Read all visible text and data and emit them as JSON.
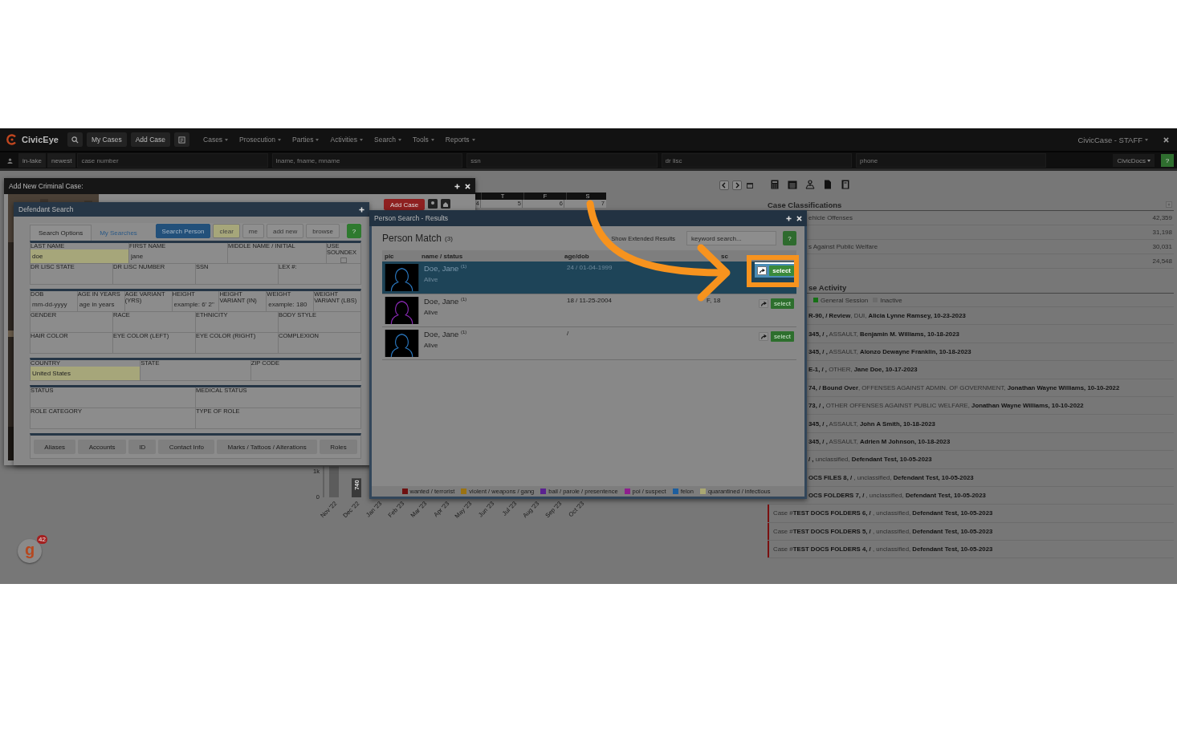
{
  "nav": {
    "brand": "CivicEye",
    "buttons": [
      "My Cases",
      "Add Case"
    ],
    "menus": [
      "Cases",
      "Prosecution",
      "Parties",
      "Activities",
      "Search",
      "Tools",
      "Reports"
    ],
    "account": "CivicCase - STAFF"
  },
  "search_bar": {
    "toggles": [
      "in-take",
      "newest"
    ],
    "fields": [
      {
        "placeholder": "case number"
      },
      {
        "placeholder": "lname, fname, mname"
      },
      {
        "placeholder": "ssn"
      },
      {
        "placeholder": "dr lisc"
      },
      {
        "placeholder": "phone"
      }
    ],
    "docs_menu": "CivicDocs",
    "help": "?"
  },
  "calendar": {
    "days": [
      "T",
      "F",
      "S"
    ],
    "dates": [
      "4",
      "5",
      "6",
      "7"
    ]
  },
  "add_case_modal": {
    "title": "Add New Criminal Case:",
    "add_button": "Add Case"
  },
  "defendant_search": {
    "title": "Defendant Search",
    "tabs": [
      {
        "label": "Search Options",
        "selected": true
      },
      {
        "label": "My Searches",
        "selected": false
      }
    ],
    "buttons": [
      {
        "label": "Search Person",
        "kind": "primary"
      },
      {
        "label": "clear",
        "kind": "warning"
      },
      {
        "label": "me",
        "kind": "plain"
      },
      {
        "label": "add new",
        "kind": "plain"
      },
      {
        "label": "browse",
        "kind": "plain"
      },
      {
        "label": "?",
        "kind": "help"
      }
    ],
    "sections": [
      [
        [
          {
            "label": "LAST NAME",
            "value": "doe",
            "highlighted": true,
            "kind": "text"
          },
          {
            "label": "FIRST NAME",
            "value": "jane",
            "highlighted": false,
            "kind": "text"
          },
          {
            "label": "MIDDLE NAME / INITIAL",
            "highlighted": false,
            "kind": "text"
          },
          {
            "label": "USE SOUNDEX",
            "checked": false,
            "kind": "checkbox"
          }
        ],
        [
          {
            "label": "DR LISC STATE",
            "highlighted": false,
            "kind": "text"
          },
          {
            "label": "DR LISC NUMBER",
            "highlighted": false,
            "kind": "text"
          },
          {
            "label": "SSN",
            "highlighted": false,
            "kind": "text"
          },
          {
            "label": "LEX #:",
            "highlighted": false,
            "kind": "text"
          }
        ]
      ],
      [
        [
          {
            "label": "DOB",
            "placeholder": "mm-dd-yyyy",
            "highlighted": false,
            "kind": "text"
          },
          {
            "label": "AGE IN YEARS",
            "placeholder": "age in years",
            "highlighted": false,
            "kind": "text"
          },
          {
            "label": "AGE VARIANT (YRS)",
            "highlighted": false,
            "kind": "text"
          },
          {
            "label": "HEIGHT",
            "placeholder": "example: 6' 2\"",
            "highlighted": false,
            "kind": "text"
          },
          {
            "label": "HEIGHT VARIANT (IN)",
            "highlighted": false,
            "kind": "text"
          },
          {
            "label": "WEIGHT",
            "placeholder": "example: 180",
            "highlighted": false,
            "kind": "text"
          },
          {
            "label": "WEIGHT VARIANT (LBS)",
            "highlighted": false,
            "kind": "text"
          }
        ],
        [
          {
            "label": "GENDER",
            "highlighted": false,
            "kind": "text"
          },
          {
            "label": "RACE",
            "highlighted": false,
            "kind": "text"
          },
          {
            "label": "ETHNICITY",
            "highlighted": false,
            "kind": "text"
          },
          {
            "label": "BODY STYLE",
            "highlighted": false,
            "kind": "text"
          }
        ],
        [
          {
            "label": "HAIR COLOR",
            "highlighted": false,
            "kind": "text"
          },
          {
            "label": "EYE COLOR (LEFT)",
            "highlighted": false,
            "kind": "text"
          },
          {
            "label": "EYE COLOR (RIGHT)",
            "highlighted": false,
            "kind": "text"
          },
          {
            "label": "COMPLEXION",
            "highlighted": false,
            "kind": "text"
          }
        ]
      ],
      [
        [
          {
            "label": "COUNTRY",
            "value": "United States",
            "highlighted": true,
            "kind": "text"
          },
          {
            "label": "STATE",
            "highlighted": false,
            "kind": "text"
          },
          {
            "label": "ZIP CODE",
            "highlighted": false,
            "kind": "text"
          }
        ]
      ],
      [
        [
          {
            "label": "STATUS",
            "highlighted": false,
            "kind": "text"
          },
          {
            "label": "MEDICAL STATUS",
            "highlighted": false,
            "kind": "text"
          }
        ],
        [
          {
            "label": "ROLE CATEGORY",
            "highlighted": false,
            "kind": "text"
          },
          {
            "label": "TYPE OF ROLE",
            "highlighted": false,
            "kind": "text"
          }
        ]
      ]
    ],
    "sub_tabs": [
      "Aliases",
      "Accounts",
      "ID",
      "Contact Info",
      "Marks / Tattoos / Alterations",
      "Roles"
    ]
  },
  "person_search": {
    "title": "Person Search - Results",
    "heading": "Person Match",
    "count": "(3)",
    "extended": {
      "label": "Show Extended Results"
    },
    "keyword": {
      "placeholder": "keyword search..."
    },
    "help": "?",
    "columns": [
      "pic",
      "name / status",
      "age/dob",
      "sc"
    ],
    "rows": [
      {
        "name": "Doe, Jane $^{(1)}$",
        "status": "Alive",
        "age_dob": "24 / 01-04-1999",
        "color": "#2a78c0",
        "selected": true,
        "action": "select"
      },
      {
        "name": "Doe, Jane $^{(1)}$",
        "status": "Alive",
        "age_dob": "18 / 11-25-2004",
        "column_4": "F, 18",
        "color": "#8c2ab8",
        "selected": false,
        "action": "select"
      },
      {
        "name": "Doe, Jane $^{(1)}$",
        "status": "Alive",
        "age_dob": "/",
        "color": "#2a78c0",
        "selected": false,
        "action": "select"
      }
    ],
    "legend": [
      {
        "label": "wanted / terrorist",
        "color": "#6e1010"
      },
      {
        "label": "violent / weapons / gang",
        "color": "#9a7212"
      },
      {
        "label": "bail / parole / presentence",
        "color": "#5a2290"
      },
      {
        "label": "poi / suspect",
        "color": "#8e1e8e"
      },
      {
        "label": "felon",
        "color": "#1d5e9e"
      },
      {
        "label": "quarantined / infectious",
        "color": "#a9a772"
      }
    ]
  },
  "classifications": {
    "title": "Case Classifications",
    "rows": [
      {
        "label": "ehicle Offenses",
        "count": "42,359"
      },
      {
        "count": "31,198"
      },
      {
        "label": "s Against Public Welfare",
        "count": "30,031"
      },
      {
        "count": "24,548"
      }
    ]
  },
  "activity": {
    "title": "se Activity",
    "legend": [
      {
        "label": "General Session",
        "color": "#167016"
      },
      {
        "label": "Inactive",
        "color": "#6c6c6c"
      }
    ],
    "rows": [
      {
        "kind": "partial",
        "text": "**R-90, / Review**, DUI, **Alicia Lynne Ramsey, 10-23-2023**"
      },
      {
        "kind": "partial",
        "text": "**345, / ,** ASSAULT, **Benjamin M. Williams, 10-18-2023**"
      },
      {
        "kind": "partial",
        "text": "**345, / ,** ASSAULT, **Alonzo Dewayne Franklin, 10-18-2023**"
      },
      {
        "kind": "partial",
        "text": "**E-1, / ,** OTHER, **Jane Doe, 10-17-2023**"
      },
      {
        "kind": "partial",
        "text": "**74, / Bound Over**, OFFENSES AGAINST ADMIN. OF GOVERNMENT, **Jonathan Wayne Williams, 10-10-2022**"
      },
      {
        "kind": "partial",
        "text": "**73, / ,** OTHER OFFENSES AGAINST PUBLIC WELFARE, **Jonathan Wayne Williams, 10-10-2022**"
      },
      {
        "kind": "partial",
        "text": "**345, / ,** ASSAULT, **John A Smith, 10-18-2023**"
      },
      {
        "kind": "partial",
        "text": "**345, / ,** ASSAULT, **Adrien M Johnson, 10-18-2023**"
      },
      {
        "kind": "partial",
        "text": "**/ ,** unclassified, **Defendant Test, 10-05-2023**"
      },
      {
        "kind": "partial",
        "text": "**OCS FILES 8, /** , unclassified, **Defendant Test, 10-05-2023**"
      },
      {
        "kind": "partial",
        "text": "**OCS FOLDERS 7, /** , unclassified, **Defendant Test, 10-05-2023**"
      },
      {
        "kind": "full",
        "color": "#7a1010",
        "text": "Case #**TEST DOCS FOLDERS 6, /** , unclassified, **Defendant Test, 10-05-2023**"
      },
      {
        "kind": "full",
        "color": "#7a1010",
        "text": "Case #**TEST DOCS FOLDERS 5, /** , unclassified, **Defendant Test, 10-05-2023**"
      },
      {
        "kind": "full",
        "color": "#7a1010",
        "text": "Case #**TEST DOCS FOLDERS 4, /** , unclassified, **Defendant Test, 10-05-2023**"
      }
    ]
  },
  "chart": {
    "chart_data": {
      "type": "bar",
      "categories": [
        "Nov '22",
        "Dec '22",
        "Jan '23",
        "Feb '23",
        "Mar '23",
        "Apr '23",
        "May '23",
        "Jun '23",
        "Jul '23",
        "Aug '23",
        "Sep '23",
        "Oct '23"
      ],
      "values": [
        1200,
        740,
        null,
        null,
        null,
        null,
        null,
        null,
        null,
        null,
        null,
        null
      ],
      "ylim": [
        0,
        1200
      ],
      "yticks": [
        {
          "value": 0,
          "label": "0"
        },
        {
          "value": 1000,
          "label": "1k"
        }
      ],
      "value_labels": [
        null,
        "740",
        null,
        null,
        null,
        null,
        null,
        null,
        null,
        null,
        null,
        null
      ]
    }
  },
  "widget": {
    "logo": "g",
    "badge": "42"
  }
}
